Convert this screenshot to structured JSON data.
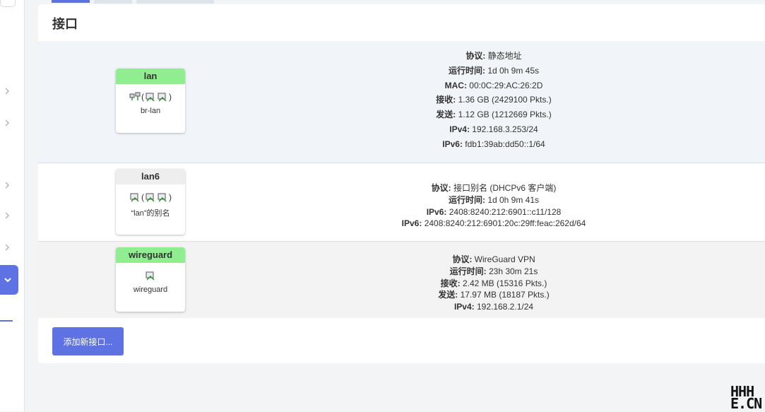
{
  "page": {
    "title": "接口"
  },
  "sidebar": {
    "active_icon": "chevron-down-icon"
  },
  "interfaces": [
    {
      "name": "lan",
      "device": "br-lan",
      "devices_group": "(",
      "devices_group_end": ")",
      "protocol_label": "协议:",
      "protocol": "静态地址",
      "uptime_label": "运行时间:",
      "uptime": "1d 0h 9m 45s",
      "mac_label": "MAC:",
      "mac": "00:0C:29:AC:26:2D",
      "rx_label": "接收:",
      "rx": "1.36 GB (2429100 Pkts.)",
      "tx_label": "发送:",
      "tx": "1.12 GB (1212669 Pkts.)",
      "ipv4_label": "IPv4:",
      "ipv4": "192.168.3.253/24",
      "ipv6_label": "IPv6:",
      "ipv6": "fdb1:39ab:dd50::1/64"
    },
    {
      "name": "lan6",
      "device": "“lan”的别名",
      "devices_group": "(",
      "devices_group_end": ")",
      "protocol_label": "协议:",
      "protocol": "接口别名 (DHCPv6 客户端)",
      "uptime_label": "运行时间:",
      "uptime": "1d 0h 9m 41s",
      "ipv6_label": "IPv6:",
      "ipv6": "2408:8240:212:6901::c11/128",
      "ipv6b_label": "IPv6:",
      "ipv6b": "2408:8240:212:6901:20c:29ff:feac:262d/64"
    },
    {
      "name": "wireguard",
      "device": "wireguard",
      "protocol_label": "协议:",
      "protocol": "WireGuard VPN",
      "uptime_label": "运行时间:",
      "uptime": "23h 30m 21s",
      "rx_label": "接收:",
      "rx": "2.42 MB (15316 Pkts.)",
      "tx_label": "发送:",
      "tx": "17.97 MB (18187 Pkts.)",
      "ipv4_label": "IPv4:",
      "ipv4": "192.168.2.1/24"
    }
  ],
  "actions": {
    "add_interface": "添加新接口..."
  },
  "watermark": {
    "line1": "HHH",
    "line2": "E.CN"
  },
  "colors": {
    "accent": "#5e72e4",
    "up": "#90ee90",
    "alias": "#eeeeee"
  }
}
